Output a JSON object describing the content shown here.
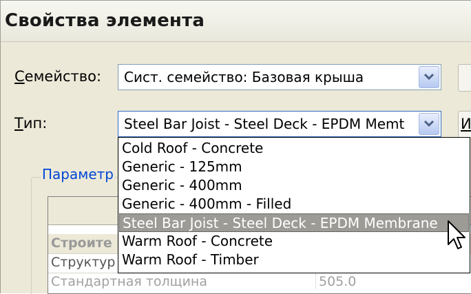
{
  "window": {
    "title": "Свойства элемента"
  },
  "family": {
    "label_underlined": "С",
    "label_rest": "емейство:",
    "value": "Сист. семейство: Базовая крыша"
  },
  "type": {
    "label_underlined": "Т",
    "label_rest": "ип:",
    "value": "Steel Bar Joist - Steel Deck - EPDM Memt",
    "side_button_underlined": "И",
    "options": [
      "Cold Roof - Concrete",
      "Generic - 125mm",
      "Generic - 400mm",
      "Generic - 400mm - Filled",
      "Steel Bar Joist - Steel Deck - EPDM Membrane",
      "Warm Roof - Concrete",
      "Warm Roof - Timber"
    ],
    "selected_index": 4
  },
  "params": {
    "group_title": "Параметр",
    "rows": [
      {
        "name": "Строите",
        "value": ""
      },
      {
        "name": "Структур",
        "value": ""
      },
      {
        "name": "Стандартная толщина",
        "value": "505.0"
      }
    ]
  },
  "colors": {
    "accent": "#0046d5",
    "dialog_bg": "#ece9d8",
    "selection": "#9c9b96"
  }
}
